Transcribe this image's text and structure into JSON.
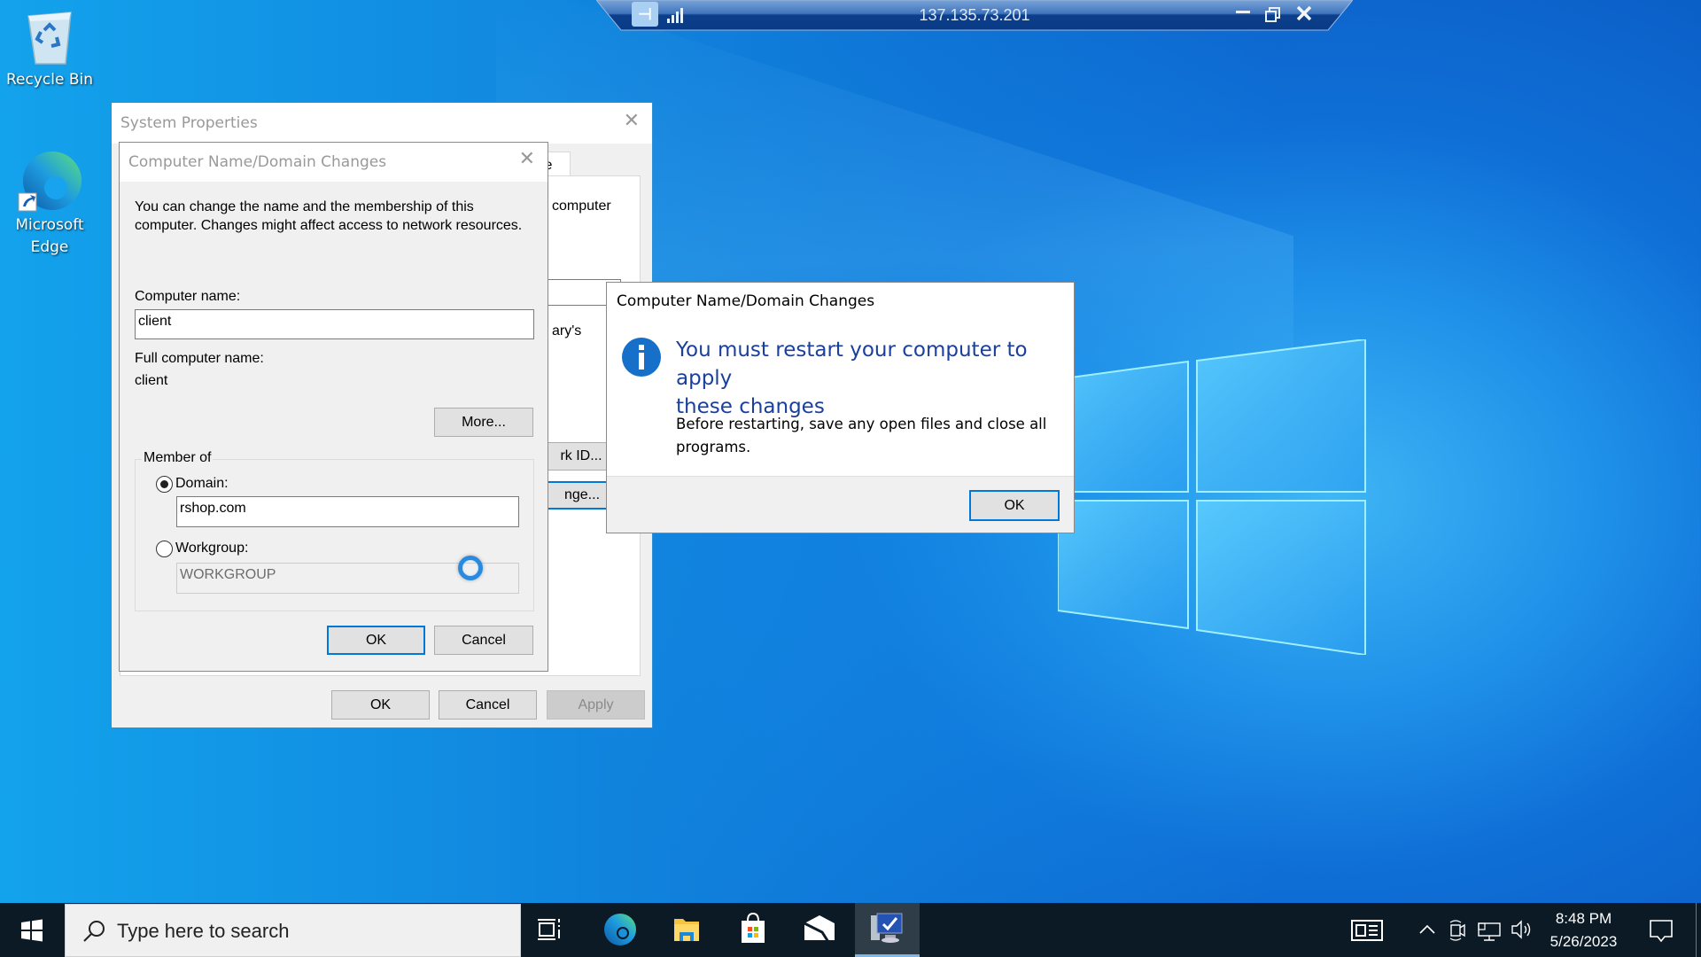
{
  "desktop": {
    "icons": [
      {
        "label": "Recycle Bin",
        "icon": "recycle-bin-icon"
      },
      {
        "label_line1": "Microsoft",
        "label_line2": "Edge",
        "icon": "edge-icon"
      }
    ]
  },
  "rdp_bar": {
    "host": "137.135.73.201",
    "pin_glyph": "⊣",
    "icons": [
      "pin-icon",
      "signal-strength-icon",
      "minimize-icon",
      "restore-icon",
      "close-icon"
    ]
  },
  "system_properties": {
    "title": "System Properties",
    "partial_tab": "te",
    "partial_text_1": "computer",
    "partial_text_2": "ary's",
    "partial_button_1": "rk ID...",
    "partial_button_2": "nge...",
    "buttons": {
      "ok": "OK",
      "cancel": "Cancel",
      "apply": "Apply"
    }
  },
  "name_dialog": {
    "title": "Computer Name/Domain Changes",
    "description_line1": "You can change the name and the membership of this",
    "description_line2": "computer. Changes might affect access to network resources.",
    "computer_name_label": "Computer name:",
    "computer_name_value": "client",
    "full_name_label": "Full computer name:",
    "full_name_value": "client",
    "more_button": "More...",
    "member_of_label": "Member of",
    "domain_label": "Domain:",
    "domain_value": "rshop.com",
    "domain_selected": true,
    "workgroup_label": "Workgroup:",
    "workgroup_value": "WORKGROUP",
    "ok": "OK",
    "cancel": "Cancel"
  },
  "restart_dialog": {
    "title": "Computer Name/Domain Changes",
    "heading_line1": "You must restart your computer to apply",
    "heading_line2": "these changes",
    "body_line1": "Before restarting, save any open files and close all",
    "body_line2": "programs.",
    "ok": "OK",
    "icon": "info-icon",
    "accent": "#1a3f9c"
  },
  "taskbar": {
    "search_placeholder": "Type here to search",
    "apps": [
      "task-view-icon",
      "edge-icon",
      "file-explorer-icon",
      "microsoft-store-icon",
      "mail-icon",
      "system-properties-icon"
    ],
    "time": "8:48 PM",
    "date": "5/26/2023"
  }
}
